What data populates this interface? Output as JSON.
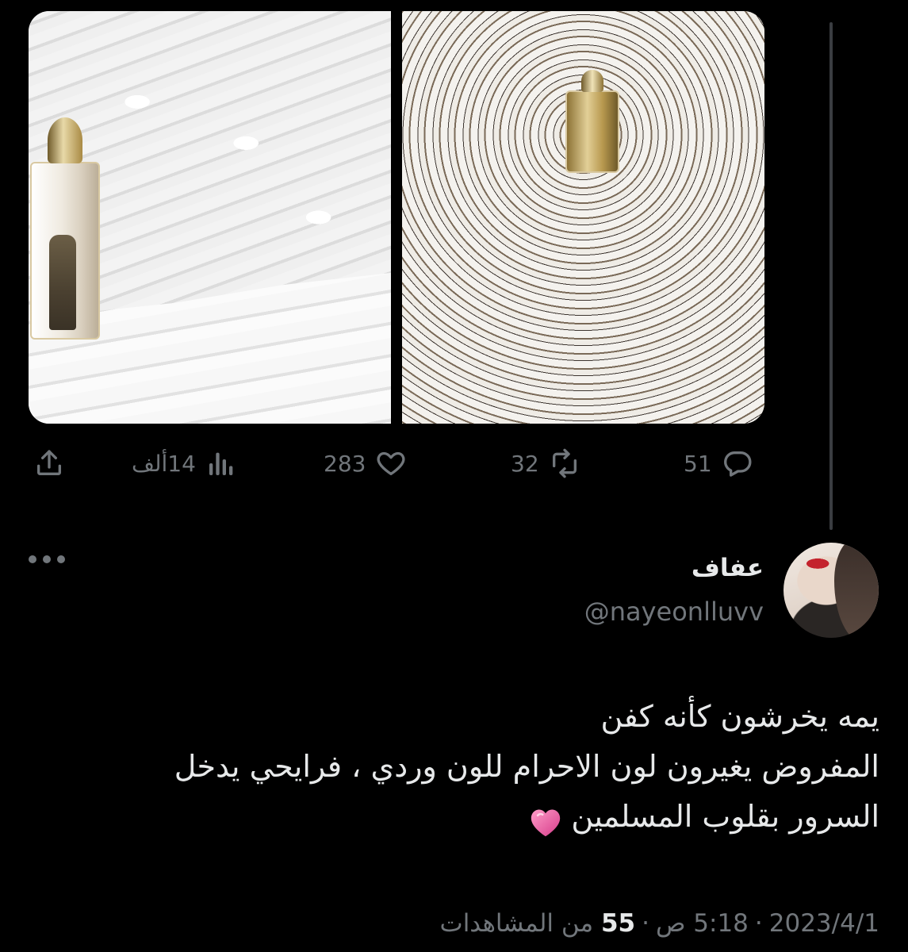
{
  "media": {
    "images": [
      {
        "name": "prayer-rows-close-up"
      },
      {
        "name": "prayer-circles-aerial"
      }
    ]
  },
  "actions": {
    "replies": "51",
    "retweets": "32",
    "likes": "283",
    "views": "14ألف"
  },
  "author": {
    "display_name": "عفاف",
    "handle": "@nayeonlluvv"
  },
  "tweet": {
    "lines": [
      "يمه يخرشون كأنه كفن",
      "المفروض يغيرون لون الاحرام للون وردي ، فرايحي يدخل",
      "السرور بقلوب المسلمين"
    ],
    "emoji": "heart-emoji"
  },
  "meta": {
    "date": "2023/4/1",
    "time": "5:18 ص",
    "views_count": "55",
    "views_label": "من المشاهدات"
  },
  "icons": {
    "reply": "reply-icon",
    "retweet": "retweet-icon",
    "like": "like-icon",
    "views": "views-icon",
    "share": "share-icon",
    "more": "more-icon"
  },
  "colors": {
    "background": "#000000",
    "text": "#e7e9ea",
    "secondary": "#71767b",
    "emoji": "#f06aa8"
  }
}
